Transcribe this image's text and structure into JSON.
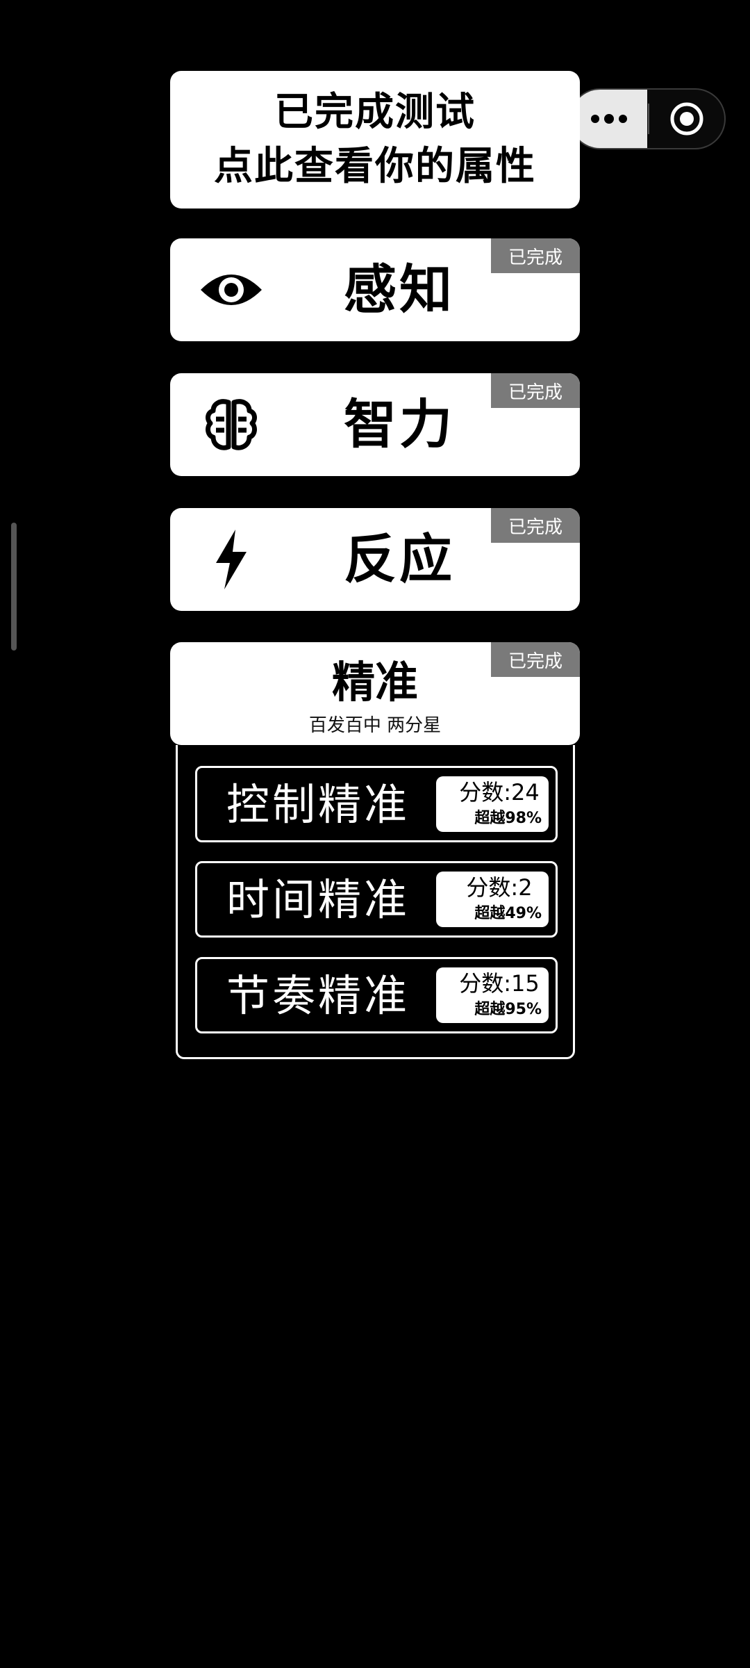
{
  "header": {
    "line1": "已完成测试",
    "line2": "点此查看你的属性"
  },
  "badge_label": "已完成",
  "attributes": [
    {
      "label": "感知",
      "icon": "eye-icon"
    },
    {
      "label": "智力",
      "icon": "brain-icon"
    },
    {
      "label": "反应",
      "icon": "lightning-icon"
    }
  ],
  "precision": {
    "title": "精准",
    "subtitle": "百发百中 两分星",
    "rows": [
      {
        "name": "控制精准",
        "score": "分数:24",
        "beat": "超越98%"
      },
      {
        "name": "时间精准",
        "score": "分数:2",
        "beat": "超越49%"
      },
      {
        "name": "节奏精准",
        "score": "分数:15",
        "beat": "超越95%"
      }
    ]
  },
  "capsule": {
    "menu_icon": "more-dots-icon",
    "close_icon": "target-circle-icon"
  },
  "colors": {
    "background": "#000000",
    "card": "#ffffff",
    "badge": "#7a7a7a"
  }
}
